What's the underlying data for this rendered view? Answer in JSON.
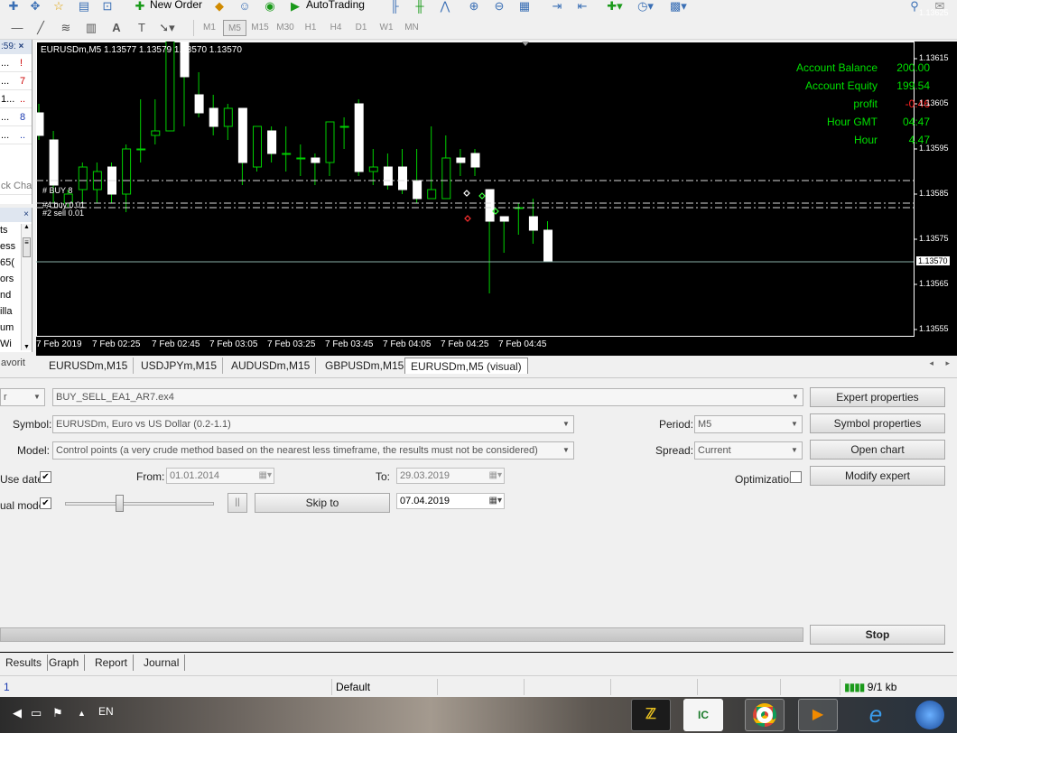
{
  "toolbar": {
    "new_order_label": "New Order",
    "autotrading_label": "AutoTrading",
    "timeframes": [
      "M1",
      "M5",
      "M15",
      "M30",
      "H1",
      "H4",
      "D1",
      "W1",
      "MN"
    ],
    "active_timeframe": "M5"
  },
  "market_watch": {
    "time_fragment": ":59:",
    "rows": [
      {
        "sym": "...",
        "val": "!",
        "val_color": "#cc0000"
      },
      {
        "sym": "...",
        "val": "7",
        "val_color": "#cc0000"
      },
      {
        "sym": "1...",
        "val": "..",
        "val_color": "#cc0000"
      },
      {
        "sym": "...",
        "val": "8",
        "val_color": "#1a3ab0"
      },
      {
        "sym": "...",
        "val": "..",
        "val_color": "#1a3ab0"
      }
    ],
    "tab_fragment": "ck Cha"
  },
  "navigator": {
    "items": [
      "ts",
      "ess",
      "65(",
      "ors",
      "nd",
      "illa",
      "um",
      "Wi"
    ],
    "tab_fragment": "avorit"
  },
  "chart": {
    "title": "EURUSDm,M5  1.13577 1.13579 1.13570 1.13570",
    "account": [
      {
        "label": "Account Balance",
        "value": "200.00",
        "color": "#00e000"
      },
      {
        "label": "Account Equity",
        "value": "199.54",
        "color": "#00e000"
      },
      {
        "label": "profit",
        "value": "-0.46",
        "color": "#ff2020"
      },
      {
        "label": "Hour GMT",
        "value": "04:47",
        "color": "#00e000"
      },
      {
        "label": "Hour",
        "value": "4.47",
        "color": "#00e000"
      }
    ],
    "order_labels": [
      "#  BUY 8",
      "#4 buy 0.01",
      "#2 sell 0.01"
    ],
    "x_ticks": [
      "7 Feb 2019",
      "7 Feb 02:25",
      "7 Feb 02:45",
      "7 Feb 03:05",
      "7 Feb 03:25",
      "7 Feb 03:45",
      "7 Feb 04:05",
      "7 Feb 04:25",
      "7 Feb 04:45"
    ],
    "y_ticks": [
      "1.13625",
      "1.13615",
      "1.13605",
      "1.13595",
      "1.13585",
      "1.13575",
      "1.13565",
      "1.13555"
    ],
    "current_price": "1.13570"
  },
  "chart_data": {
    "type": "candlestick",
    "y_range": [
      1.1355,
      1.1363
    ],
    "current_price": 1.1357,
    "order_levels": [
      1.13588,
      1.13583,
      1.13582
    ],
    "candles": [
      {
        "o": 1.13603,
        "h": 1.13605,
        "c": 1.13598,
        "l": 1.13597
      },
      {
        "o": 1.13597,
        "h": 1.13599,
        "c": 1.13587,
        "l": 1.13583
      },
      {
        "o": 1.13583,
        "h": 1.13586,
        "c": 1.13585,
        "l": 1.13582
      },
      {
        "o": 1.13586,
        "h": 1.13592,
        "c": 1.13591,
        "l": 1.13583
      },
      {
        "o": 1.13586,
        "h": 1.13592,
        "c": 1.1359,
        "l": 1.13583
      },
      {
        "o": 1.13591,
        "h": 1.13592,
        "c": 1.13585,
        "l": 1.13583
      },
      {
        "o": 1.13585,
        "h": 1.13596,
        "c": 1.13595,
        "l": 1.13581
      },
      {
        "o": 1.13595,
        "h": 1.13606,
        "c": 1.13595,
        "l": 1.13592
      },
      {
        "o": 1.13598,
        "h": 1.13606,
        "c": 1.13599,
        "l": 1.13596
      },
      {
        "o": 1.13599,
        "h": 1.13627,
        "c": 1.1362,
        "l": 1.13599
      },
      {
        "o": 1.1362,
        "h": 1.13622,
        "c": 1.13611,
        "l": 1.136
      },
      {
        "o": 1.13607,
        "h": 1.13612,
        "c": 1.13603,
        "l": 1.13602
      },
      {
        "o": 1.13604,
        "h": 1.13607,
        "c": 1.136,
        "l": 1.13598
      },
      {
        "o": 1.136,
        "h": 1.13605,
        "c": 1.13604,
        "l": 1.13597
      },
      {
        "o": 1.13604,
        "h": 1.13604,
        "c": 1.13592,
        "l": 1.13587
      },
      {
        "o": 1.13591,
        "h": 1.136,
        "c": 1.136,
        "l": 1.1359
      },
      {
        "o": 1.13599,
        "h": 1.136,
        "c": 1.13594,
        "l": 1.13592
      },
      {
        "o": 1.13594,
        "h": 1.136,
        "c": 1.13594,
        "l": 1.1359
      },
      {
        "o": 1.13593,
        "h": 1.13596,
        "c": 1.13593,
        "l": 1.13589
      },
      {
        "o": 1.13593,
        "h": 1.13594,
        "c": 1.13592,
        "l": 1.13587
      },
      {
        "o": 1.13592,
        "h": 1.13601,
        "c": 1.13601,
        "l": 1.13589
      },
      {
        "o": 1.136,
        "h": 1.13602,
        "c": 1.136,
        "l": 1.13595
      },
      {
        "o": 1.13605,
        "h": 1.13606,
        "c": 1.1359,
        "l": 1.13589
      },
      {
        "o": 1.1359,
        "h": 1.13595,
        "c": 1.13591,
        "l": 1.13587
      },
      {
        "o": 1.13591,
        "h": 1.13594,
        "c": 1.13587,
        "l": 1.13586
      },
      {
        "o": 1.13591,
        "h": 1.13595,
        "c": 1.13586,
        "l": 1.13585
      },
      {
        "o": 1.13588,
        "h": 1.13595,
        "c": 1.13584,
        "l": 1.13583
      },
      {
        "o": 1.13584,
        "h": 1.136,
        "c": 1.13586,
        "l": 1.13584
      },
      {
        "o": 1.13584,
        "h": 1.13598,
        "c": 1.13593,
        "l": 1.13584
      },
      {
        "o": 1.13593,
        "h": 1.13595,
        "c": 1.13592,
        "l": 1.13589
      },
      {
        "o": 1.13594,
        "h": 1.13595,
        "c": 1.13591,
        "l": 1.13589
      },
      {
        "o": 1.13586,
        "h": 1.13586,
        "c": 1.13579,
        "l": 1.13563
      },
      {
        "o": 1.1358,
        "h": 1.1358,
        "c": 1.13579,
        "l": 1.13572
      },
      {
        "o": 1.13582,
        "h": 1.13583,
        "c": 1.13582,
        "l": 1.13576
      },
      {
        "o": 1.1358,
        "h": 1.13584,
        "c": 1.13577,
        "l": 1.13574
      },
      {
        "o": 1.13577,
        "h": 1.13579,
        "c": 1.1357,
        "l": 1.1357
      }
    ]
  },
  "chart_tabs": [
    "EURUSDm,M15",
    "USDJPYm,M15",
    "AUDUSDm,M15",
    "GBPUSDm,M15",
    "EURUSDm,M5 (visual)"
  ],
  "active_chart_tab": "EURUSDm,M5 (visual)",
  "tester": {
    "ea_type_fragment": "r",
    "expert": "BUY_SELL_EA1_AR7.ex4",
    "symbol_label": "Symbol:",
    "symbol": "EURUSDm, Euro vs US Dollar (0.2-1.1)",
    "model_label": "Model:",
    "model": "Control points (a very crude method based on the nearest less timeframe, the results must not be considered)",
    "use_date_label": "Use date",
    "from_label": "From:",
    "from_date": "01.01.2014",
    "to_label": "To:",
    "to_date": "29.03.2019",
    "visual_mode_label": "ual mode",
    "pause_label": "||",
    "skip_to_label": "Skip to",
    "skip_date": "07.04.2019",
    "period_label": "Period:",
    "period": "M5",
    "spread_label": "Spread:",
    "spread": "Current",
    "optimization_label": "Optimization",
    "expert_properties_label": "Expert properties",
    "symbol_properties_label": "Symbol properties",
    "open_chart_label": "Open chart",
    "modify_expert_label": "Modify expert",
    "stop_label": "Stop",
    "speed": 0.36
  },
  "bottom_tabs": [
    "Results",
    "Graph",
    "Report",
    "Journal"
  ],
  "statusbar": {
    "left_fragment": "1",
    "profile": "Default",
    "traffic": "9/1 kb"
  },
  "taskbar": {
    "language": "EN"
  }
}
